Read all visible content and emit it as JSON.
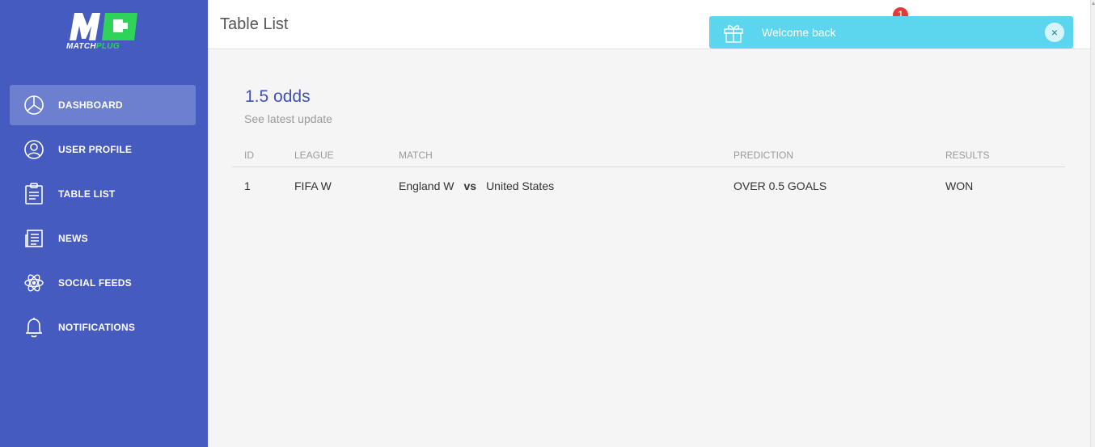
{
  "brand": {
    "logo_main": "MATCH",
    "logo_accent": "PLUG"
  },
  "sidebar": {
    "items": [
      {
        "label": "DASHBOARD",
        "icon": "pie-chart-icon",
        "active": true
      },
      {
        "label": "USER PROFILE",
        "icon": "user-icon",
        "active": false
      },
      {
        "label": "TABLE LIST",
        "icon": "clipboard-icon",
        "active": false
      },
      {
        "label": "NEWS",
        "icon": "newspaper-icon",
        "active": false
      },
      {
        "label": "SOCIAL FEEDS",
        "icon": "atom-icon",
        "active": false
      },
      {
        "label": "NOTIFICATIONS",
        "icon": "bell-icon",
        "active": false
      }
    ]
  },
  "header": {
    "title": "Table List",
    "notification_count": "1"
  },
  "toast": {
    "message": "Welcome back",
    "icon": "gift-icon",
    "close_label": "×"
  },
  "card": {
    "title": "1.5 odds",
    "subtitle": "See latest update",
    "columns": [
      "ID",
      "LEAGUE",
      "MATCH",
      "PREDICTION",
      "RESULTS"
    ],
    "rows": [
      {
        "id": "1",
        "league": "FIFA W",
        "home": "England W",
        "vs": "vs",
        "away": "United States",
        "prediction": "OVER 0.5 GOALS",
        "result": "WON"
      }
    ]
  },
  "colors": {
    "sidebar": "#455bc0",
    "sidebar_active": "#6d80cf",
    "accent": "#3f51b5",
    "toast": "#5bd6ee",
    "badge": "#e53935",
    "logo_green": "#2fd35a"
  }
}
